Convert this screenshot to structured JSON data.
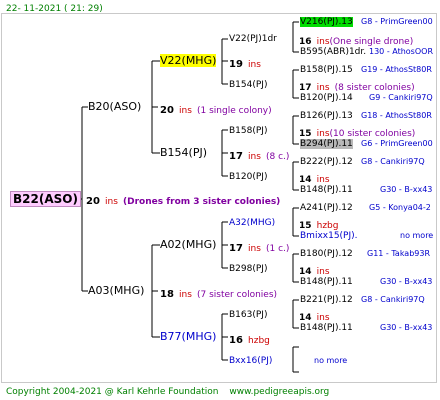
{
  "header": {
    "timestamp": "22- 11-2021 ( 21: 29)"
  },
  "footer": {
    "copyright": "Copyright 2004-2021 @ Karl Kehrle Foundation",
    "url": "www.pedigreeapis.org"
  },
  "root": {
    "label": "B22(ASO)",
    "count": "20",
    "ins": "ins",
    "note": "(Drones from 3 sister colonies)"
  },
  "parents": {
    "top": {
      "label": "B20(ASO)",
      "count": "20",
      "ins": "ins",
      "note": "(1 single colony)"
    },
    "bottom": {
      "label": "A03(MHG)",
      "count": "18",
      "ins": "ins",
      "note": "(7 sister colonies)"
    }
  },
  "grandparents": {
    "v22": {
      "label": "V22(MHG)",
      "count": "19",
      "ins": "ins"
    },
    "b154": {
      "label": "B154(PJ)",
      "count": "17",
      "ins": "ins",
      "note": "(8 c.)"
    },
    "a02": {
      "label": "A02(MHG)",
      "count": "17",
      "ins": "ins",
      "note": "(1 c.)"
    },
    "b77": {
      "label": "B77(MHG)",
      "count": "16",
      "ins": "hzbg"
    }
  },
  "ggp": {
    "v22pj": {
      "label": "V22(PJ)1dr",
      "count": "16",
      "ins": "ins",
      "note": "(One single drone)"
    },
    "b154pj_a": {
      "label": "B154(PJ)",
      "count": "17",
      "ins": "ins",
      "note": "(8 sister colonies)"
    },
    "b158pj": {
      "label": "B158(PJ)",
      "count": "15",
      "ins": "ins",
      "note": "(10 sister colonies)"
    },
    "b120pj_a": {
      "label": "B120(PJ)",
      "count": "14",
      "ins": "ins"
    },
    "a32mhg": {
      "label": "A32(MHG)",
      "count": "15",
      "ins": "hzbg"
    },
    "b298pj": {
      "label": "B298(PJ)",
      "count": "14",
      "ins": "ins"
    },
    "b163pj": {
      "label": "B163(PJ)",
      "count": "14",
      "ins": "ins"
    },
    "bxx16pj": {
      "label": "Bxx16(PJ)",
      "note": "no more"
    }
  },
  "right_rows": [
    {
      "name": "V216(PJ).13",
      "extra": "G8 - PrimGreen00",
      "hl": "green"
    },
    {
      "name": "B595(ABR)1dr.",
      "extra": "130 - AthosOOR"
    },
    {
      "name": "B158(PJ).15",
      "extra": "G19 - AthosSt80R"
    },
    {
      "name": "B120(PJ).14",
      "extra": "G9 - Cankiri97Q"
    },
    {
      "name": "B126(PJ).13",
      "extra": "G18 - AthosSt80R"
    },
    {
      "name": "B294(PJ).11",
      "extra": "G6 - PrimGreen00",
      "hl": "grey"
    },
    {
      "name": "B222(PJ).12",
      "extra": "G8 - Cankiri97Q"
    },
    {
      "name": "B148(PJ).11",
      "extra": "G30 - B-xx43"
    },
    {
      "name": "A241(PJ).12",
      "extra": "G5 - Konya04-2"
    },
    {
      "name": "Bmixx15(PJ).",
      "extra": "no more"
    },
    {
      "name": "B180(PJ).12",
      "extra": "G11 - Takab93R"
    },
    {
      "name": "B148(PJ).11",
      "extra": "G30 - B-xx43"
    },
    {
      "name": "B221(PJ).12",
      "extra": "G8 - Cankiri97Q"
    },
    {
      "name": "B148(PJ).11",
      "extra": "G30 - B-xx43"
    }
  ]
}
